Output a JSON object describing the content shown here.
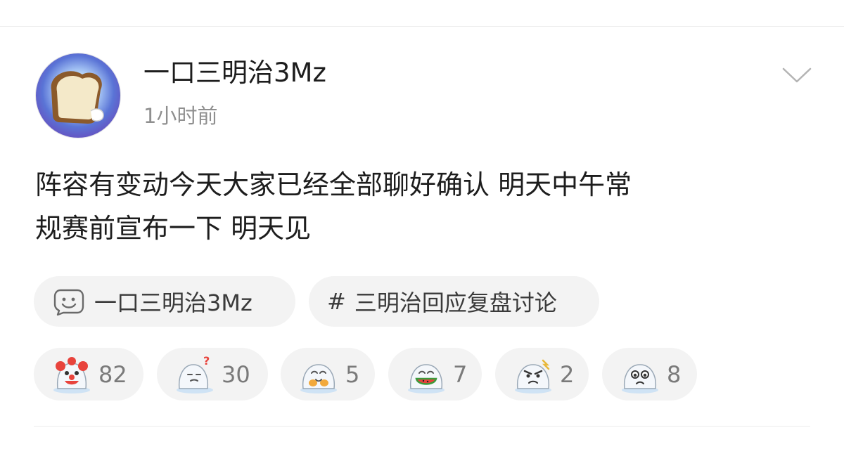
{
  "post": {
    "author": "一口三明治3Mz",
    "time": "1小时前",
    "text_line1": "阵容有变动今天大家已经全部聊好确认 明天中午常",
    "text_line2": "规赛前宣布一下 明天见"
  },
  "tags": {
    "author_chip": {
      "label": "一口三明治3Mz",
      "icon": "super-chat-face-icon"
    },
    "topic_chip": {
      "hash": "#",
      "label": "三明治回应复盘讨论"
    }
  },
  "reactions": [
    {
      "icon": "clown-seal-emoji",
      "count": "82"
    },
    {
      "icon": "question-seal-emoji",
      "count": "30"
    },
    {
      "icon": "clap-seal-emoji",
      "count": "5"
    },
    {
      "icon": "watermelon-seal-emoji",
      "count": "7"
    },
    {
      "icon": "angry-seal-emoji",
      "count": "2"
    },
    {
      "icon": "sad-seal-emoji",
      "count": "8"
    }
  ],
  "colors": {
    "text": "#1d1d1d",
    "secondary": "#8f8f8f",
    "chip_bg": "#f3f3f3",
    "seal": "#eef3f8"
  }
}
